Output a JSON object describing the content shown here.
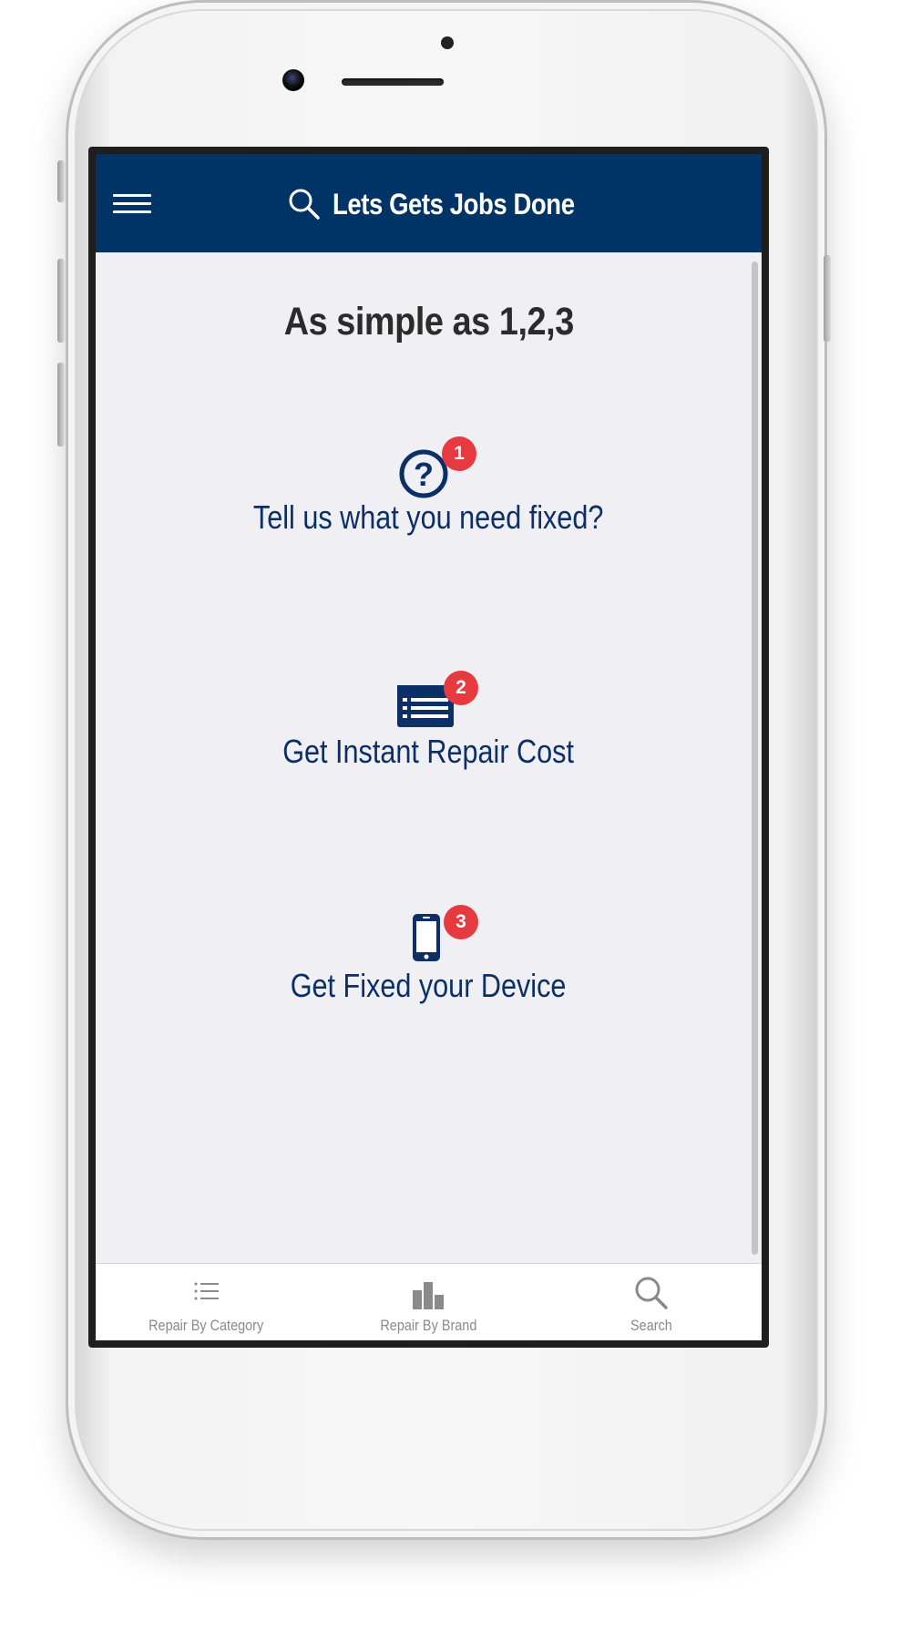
{
  "header": {
    "title": "Lets Gets Jobs Done",
    "menu_icon": "hamburger-menu-icon",
    "search_icon": "search-icon"
  },
  "main": {
    "heading": "As simple as 1,2,3",
    "steps": [
      {
        "badge": "1",
        "label": "Tell us what you need fixed?",
        "icon": "question-circle-icon"
      },
      {
        "badge": "2",
        "label": "Get Instant Repair Cost",
        "icon": "price-list-icon"
      },
      {
        "badge": "3",
        "label": "Get Fixed your Device",
        "icon": "smartphone-icon"
      }
    ]
  },
  "tabbar": {
    "tabs": [
      {
        "label": "Repair By Category",
        "icon": "list-icon"
      },
      {
        "label": "Repair By Brand",
        "icon": "bar-chart-icon"
      },
      {
        "label": "Search",
        "icon": "search-icon"
      }
    ]
  },
  "colors": {
    "header_bg": "#003366",
    "accent_text": "#0b2f66",
    "badge": "#e53a3f",
    "content_bg": "#efeff4",
    "tab_text": "#8a8a8a"
  }
}
